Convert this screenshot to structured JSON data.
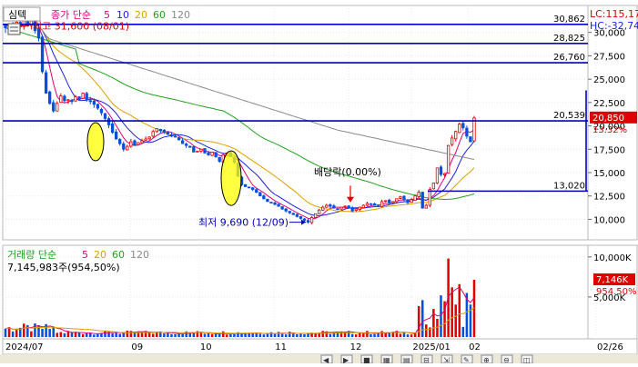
{
  "header": {
    "chart_label": "심텍",
    "ma_title": "종가 단순",
    "ma_periods": [
      "5",
      "10",
      "20",
      "60",
      "120"
    ],
    "ma_colors": [
      "#e0007a",
      "#2020e0",
      "#e0a000",
      "#20a020",
      "#8a8a8a"
    ],
    "lc_text": "LC:115,17",
    "hc_text": "HC:-32,74"
  },
  "chart_data": [
    {
      "type": "candlestick",
      "name": "price",
      "title": "",
      "ylim": [
        8000,
        32500
      ],
      "y_ticks": [
        10000,
        12500,
        15000,
        17500,
        20000,
        22500,
        25000,
        27500,
        30000
      ],
      "y_tick_labels": [
        "10,000",
        "12,500",
        "15,000",
        "17,500",
        "20,000",
        "22,500",
        "25,000",
        "27,500",
        "30,000"
      ],
      "x_labels": [
        "2024/07",
        "09",
        "10",
        "11",
        "12",
        "2025/01",
        "02",
        "02/26"
      ],
      "horizontal_levels": [
        {
          "value": 30862,
          "label": "30,862"
        },
        {
          "value": 28825,
          "label": "28,825"
        },
        {
          "value": 26760,
          "label": "26,760"
        },
        {
          "value": 20539,
          "label": "20,539"
        },
        {
          "value": 13020,
          "label": "13,020"
        }
      ],
      "current_price": {
        "value": 20850,
        "label": "20,850",
        "change": "13.32%"
      },
      "annotations": {
        "high": {
          "label": "최고 31,600 (08/01)",
          "value": 31600
        },
        "low": {
          "label": "최저 9,690 (12/09)",
          "value": 9690
        },
        "dividend": {
          "label": "배당락(0.00%)"
        }
      },
      "close": [
        30500,
        30800,
        30300,
        31100,
        30600,
        31300,
        30800,
        31600,
        30200,
        29400,
        25800,
        23500,
        22400,
        21600,
        22400,
        23200,
        22700,
        22800,
        22600,
        23100,
        22900,
        23500,
        22800,
        22700,
        22300,
        21900,
        21400,
        20800,
        20100,
        19300,
        18600,
        18100,
        17500,
        17800,
        18300,
        17900,
        18200,
        18400,
        18600,
        18800,
        19400,
        19700,
        19500,
        19300,
        19100,
        18900,
        18800,
        18500,
        18100,
        17900,
        17700,
        17200,
        17300,
        17500,
        17100,
        16900,
        17200,
        16700,
        16200,
        16900,
        17100,
        16700,
        16100,
        14600,
        13700,
        13500,
        13400,
        13200,
        12900,
        12500,
        12200,
        11900,
        11800,
        11600,
        11400,
        11100,
        10900,
        10700,
        10500,
        10300,
        10100,
        9900,
        9690,
        10200,
        10600,
        11000,
        11300,
        11500,
        11400,
        11200,
        11100,
        11300,
        11400,
        11200,
        10900,
        11100,
        11300,
        11500,
        11700,
        11600,
        11500,
        11400,
        11900,
        12000,
        11800,
        11900,
        12200,
        12400,
        12100,
        11800,
        12100,
        12500,
        12900,
        11200,
        11500,
        13200,
        13900,
        15500,
        14800,
        14900,
        17900,
        18700,
        19400,
        20200,
        19800,
        18900,
        18300,
        20850
      ],
      "volume_title": "거래량 단순",
      "volume_ma_periods": [
        "5",
        "20",
        "60",
        "120"
      ],
      "volume_ma_colors": [
        "#e0007a",
        "#e0a000",
        "#20a020",
        "#8a8a8a"
      ]
    },
    {
      "type": "bar",
      "name": "volume",
      "ylim": [
        0,
        11000000
      ],
      "y_ticks": [
        5000000,
        10000000
      ],
      "y_tick_labels": [
        "5,000K",
        "10,000K"
      ],
      "current_volume": {
        "label": "7,146K",
        "ratio": "954.50%"
      },
      "volume_text": "7,145,983주(954,50%)"
    }
  ],
  "footer": {
    "scroll_icons": [
      "◀",
      "▶",
      "■",
      "▦",
      "▤",
      "⊟",
      "⇲",
      "✎",
      "⊕",
      "⊖",
      "◫"
    ]
  }
}
